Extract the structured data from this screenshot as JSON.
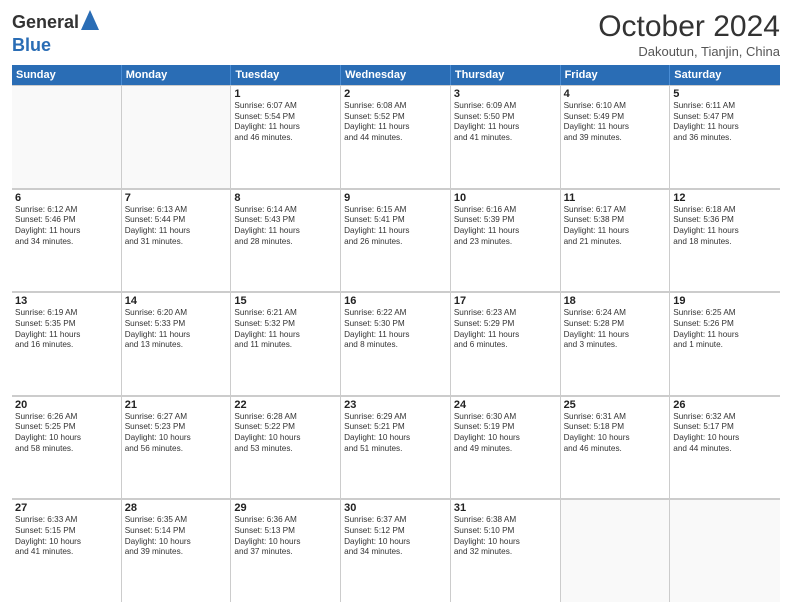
{
  "header": {
    "logo_general": "General",
    "logo_blue": "Blue",
    "title": "October 2024",
    "location": "Dakoutun, Tianjin, China"
  },
  "days_of_week": [
    "Sunday",
    "Monday",
    "Tuesday",
    "Wednesday",
    "Thursday",
    "Friday",
    "Saturday"
  ],
  "weeks": [
    [
      {
        "day": "",
        "sunrise": "",
        "sunset": "",
        "daylight": "",
        "empty": true
      },
      {
        "day": "",
        "sunrise": "",
        "sunset": "",
        "daylight": "",
        "empty": true
      },
      {
        "day": "1",
        "sunrise": "Sunrise: 6:07 AM",
        "sunset": "Sunset: 5:54 PM",
        "daylight": "Daylight: 11 hours and 46 minutes."
      },
      {
        "day": "2",
        "sunrise": "Sunrise: 6:08 AM",
        "sunset": "Sunset: 5:52 PM",
        "daylight": "Daylight: 11 hours and 44 minutes."
      },
      {
        "day": "3",
        "sunrise": "Sunrise: 6:09 AM",
        "sunset": "Sunset: 5:50 PM",
        "daylight": "Daylight: 11 hours and 41 minutes."
      },
      {
        "day": "4",
        "sunrise": "Sunrise: 6:10 AM",
        "sunset": "Sunset: 5:49 PM",
        "daylight": "Daylight: 11 hours and 39 minutes."
      },
      {
        "day": "5",
        "sunrise": "Sunrise: 6:11 AM",
        "sunset": "Sunset: 5:47 PM",
        "daylight": "Daylight: 11 hours and 36 minutes."
      }
    ],
    [
      {
        "day": "6",
        "sunrise": "Sunrise: 6:12 AM",
        "sunset": "Sunset: 5:46 PM",
        "daylight": "Daylight: 11 hours and 34 minutes."
      },
      {
        "day": "7",
        "sunrise": "Sunrise: 6:13 AM",
        "sunset": "Sunset: 5:44 PM",
        "daylight": "Daylight: 11 hours and 31 minutes."
      },
      {
        "day": "8",
        "sunrise": "Sunrise: 6:14 AM",
        "sunset": "Sunset: 5:43 PM",
        "daylight": "Daylight: 11 hours and 28 minutes."
      },
      {
        "day": "9",
        "sunrise": "Sunrise: 6:15 AM",
        "sunset": "Sunset: 5:41 PM",
        "daylight": "Daylight: 11 hours and 26 minutes."
      },
      {
        "day": "10",
        "sunrise": "Sunrise: 6:16 AM",
        "sunset": "Sunset: 5:39 PM",
        "daylight": "Daylight: 11 hours and 23 minutes."
      },
      {
        "day": "11",
        "sunrise": "Sunrise: 6:17 AM",
        "sunset": "Sunset: 5:38 PM",
        "daylight": "Daylight: 11 hours and 21 minutes."
      },
      {
        "day": "12",
        "sunrise": "Sunrise: 6:18 AM",
        "sunset": "Sunset: 5:36 PM",
        "daylight": "Daylight: 11 hours and 18 minutes."
      }
    ],
    [
      {
        "day": "13",
        "sunrise": "Sunrise: 6:19 AM",
        "sunset": "Sunset: 5:35 PM",
        "daylight": "Daylight: 11 hours and 16 minutes."
      },
      {
        "day": "14",
        "sunrise": "Sunrise: 6:20 AM",
        "sunset": "Sunset: 5:33 PM",
        "daylight": "Daylight: 11 hours and 13 minutes."
      },
      {
        "day": "15",
        "sunrise": "Sunrise: 6:21 AM",
        "sunset": "Sunset: 5:32 PM",
        "daylight": "Daylight: 11 hours and 11 minutes."
      },
      {
        "day": "16",
        "sunrise": "Sunrise: 6:22 AM",
        "sunset": "Sunset: 5:30 PM",
        "daylight": "Daylight: 11 hours and 8 minutes."
      },
      {
        "day": "17",
        "sunrise": "Sunrise: 6:23 AM",
        "sunset": "Sunset: 5:29 PM",
        "daylight": "Daylight: 11 hours and 6 minutes."
      },
      {
        "day": "18",
        "sunrise": "Sunrise: 6:24 AM",
        "sunset": "Sunset: 5:28 PM",
        "daylight": "Daylight: 11 hours and 3 minutes."
      },
      {
        "day": "19",
        "sunrise": "Sunrise: 6:25 AM",
        "sunset": "Sunset: 5:26 PM",
        "daylight": "Daylight: 11 hours and 1 minute."
      }
    ],
    [
      {
        "day": "20",
        "sunrise": "Sunrise: 6:26 AM",
        "sunset": "Sunset: 5:25 PM",
        "daylight": "Daylight: 10 hours and 58 minutes."
      },
      {
        "day": "21",
        "sunrise": "Sunrise: 6:27 AM",
        "sunset": "Sunset: 5:23 PM",
        "daylight": "Daylight: 10 hours and 56 minutes."
      },
      {
        "day": "22",
        "sunrise": "Sunrise: 6:28 AM",
        "sunset": "Sunset: 5:22 PM",
        "daylight": "Daylight: 10 hours and 53 minutes."
      },
      {
        "day": "23",
        "sunrise": "Sunrise: 6:29 AM",
        "sunset": "Sunset: 5:21 PM",
        "daylight": "Daylight: 10 hours and 51 minutes."
      },
      {
        "day": "24",
        "sunrise": "Sunrise: 6:30 AM",
        "sunset": "Sunset: 5:19 PM",
        "daylight": "Daylight: 10 hours and 49 minutes."
      },
      {
        "day": "25",
        "sunrise": "Sunrise: 6:31 AM",
        "sunset": "Sunset: 5:18 PM",
        "daylight": "Daylight: 10 hours and 46 minutes."
      },
      {
        "day": "26",
        "sunrise": "Sunrise: 6:32 AM",
        "sunset": "Sunset: 5:17 PM",
        "daylight": "Daylight: 10 hours and 44 minutes."
      }
    ],
    [
      {
        "day": "27",
        "sunrise": "Sunrise: 6:33 AM",
        "sunset": "Sunset: 5:15 PM",
        "daylight": "Daylight: 10 hours and 41 minutes."
      },
      {
        "day": "28",
        "sunrise": "Sunrise: 6:35 AM",
        "sunset": "Sunset: 5:14 PM",
        "daylight": "Daylight: 10 hours and 39 minutes."
      },
      {
        "day": "29",
        "sunrise": "Sunrise: 6:36 AM",
        "sunset": "Sunset: 5:13 PM",
        "daylight": "Daylight: 10 hours and 37 minutes."
      },
      {
        "day": "30",
        "sunrise": "Sunrise: 6:37 AM",
        "sunset": "Sunset: 5:12 PM",
        "daylight": "Daylight: 10 hours and 34 minutes."
      },
      {
        "day": "31",
        "sunrise": "Sunrise: 6:38 AM",
        "sunset": "Sunset: 5:10 PM",
        "daylight": "Daylight: 10 hours and 32 minutes."
      },
      {
        "day": "",
        "sunrise": "",
        "sunset": "",
        "daylight": "",
        "empty": true
      },
      {
        "day": "",
        "sunrise": "",
        "sunset": "",
        "daylight": "",
        "empty": true
      }
    ]
  ]
}
